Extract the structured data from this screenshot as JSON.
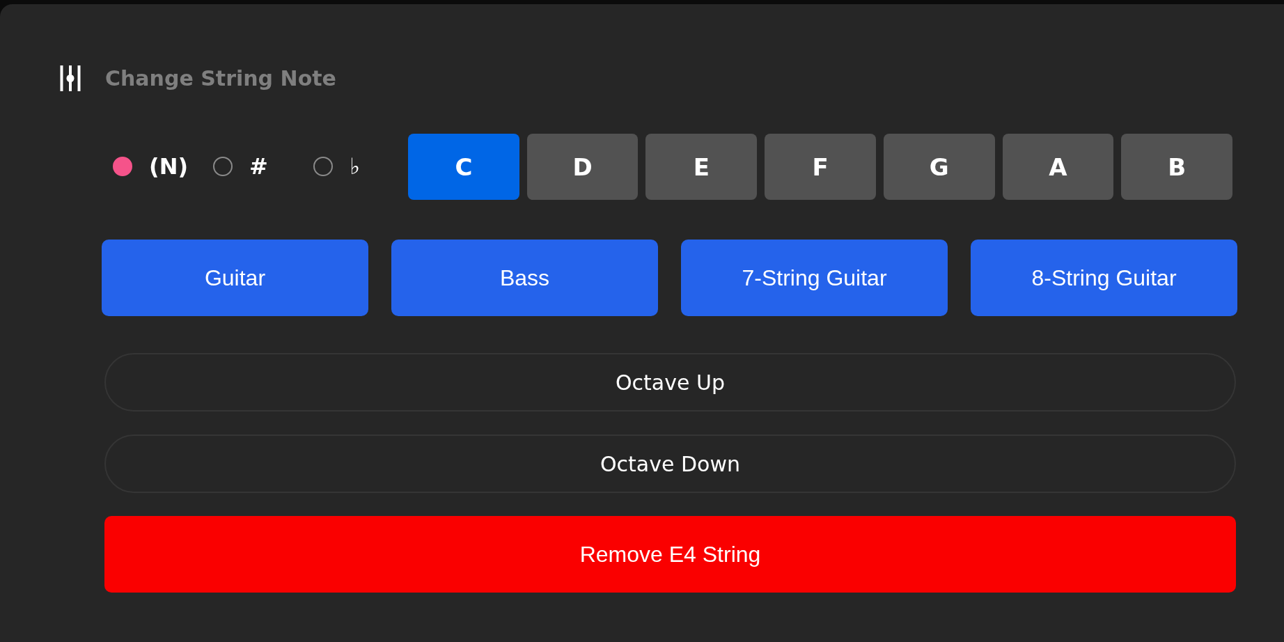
{
  "header": {
    "title": "Change String Note"
  },
  "accidentals": [
    {
      "label": "(N)",
      "selected": true
    },
    {
      "label": "#",
      "selected": false
    },
    {
      "label": "♭",
      "selected": false
    }
  ],
  "notes": [
    {
      "label": "C",
      "selected": true
    },
    {
      "label": "D",
      "selected": false
    },
    {
      "label": "E",
      "selected": false
    },
    {
      "label": "F",
      "selected": false
    },
    {
      "label": "G",
      "selected": false
    },
    {
      "label": "A",
      "selected": false
    },
    {
      "label": "B",
      "selected": false
    }
  ],
  "instruments": [
    "Guitar",
    "Bass",
    "7-String Guitar",
    "8-String Guitar"
  ],
  "actions": [
    {
      "kind": "outline",
      "label": "Octave Up"
    },
    {
      "kind": "outline",
      "label": "Octave Down"
    },
    {
      "kind": "danger",
      "label": "Remove E4 String"
    }
  ]
}
